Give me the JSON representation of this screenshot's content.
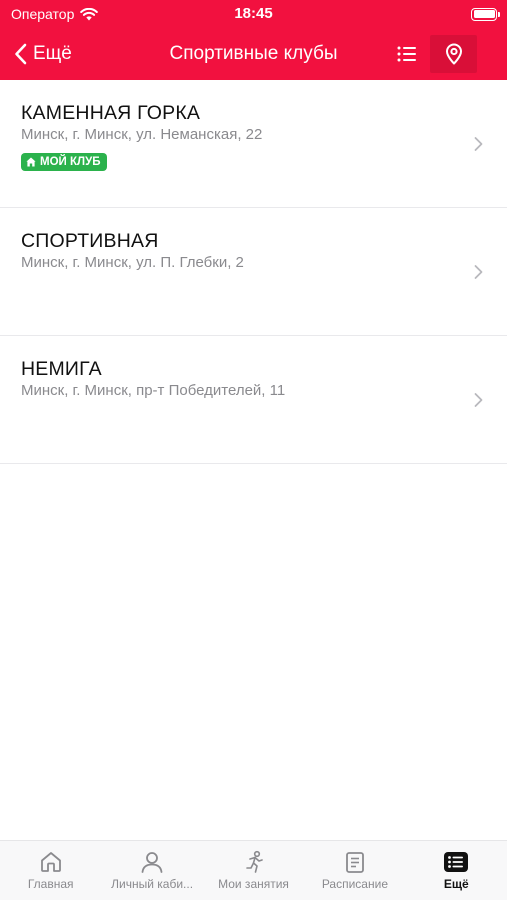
{
  "status_bar": {
    "carrier": "Оператор",
    "time": "18:45"
  },
  "nav": {
    "back_label": "Ещё",
    "title": "Спортивные клубы"
  },
  "clubs": [
    {
      "name": "КАМЕННАЯ ГОРКА",
      "address": "Минск, г. Минск, ул. Неманская, 22",
      "badge": "МОЙ КЛУБ"
    },
    {
      "name": "СПОРТИВНАЯ",
      "address": "Минск, г. Минск, ул. П. Глебки, 2"
    },
    {
      "name": "НЕМИГА",
      "address": "Минск, г. Минск, пр-т Победителей, 11"
    }
  ],
  "tabs": [
    {
      "label": "Главная",
      "icon": "home-icon"
    },
    {
      "label": "Личный каби...",
      "icon": "person-icon"
    },
    {
      "label": "Мои занятия",
      "icon": "runner-icon"
    },
    {
      "label": "Расписание",
      "icon": "document-icon"
    },
    {
      "label": "Ещё",
      "icon": "more-list-icon",
      "active": true
    }
  ],
  "colors": {
    "accent": "#f2113f",
    "badge": "#2bb24c",
    "secondary_text": "#8a8a8e"
  }
}
